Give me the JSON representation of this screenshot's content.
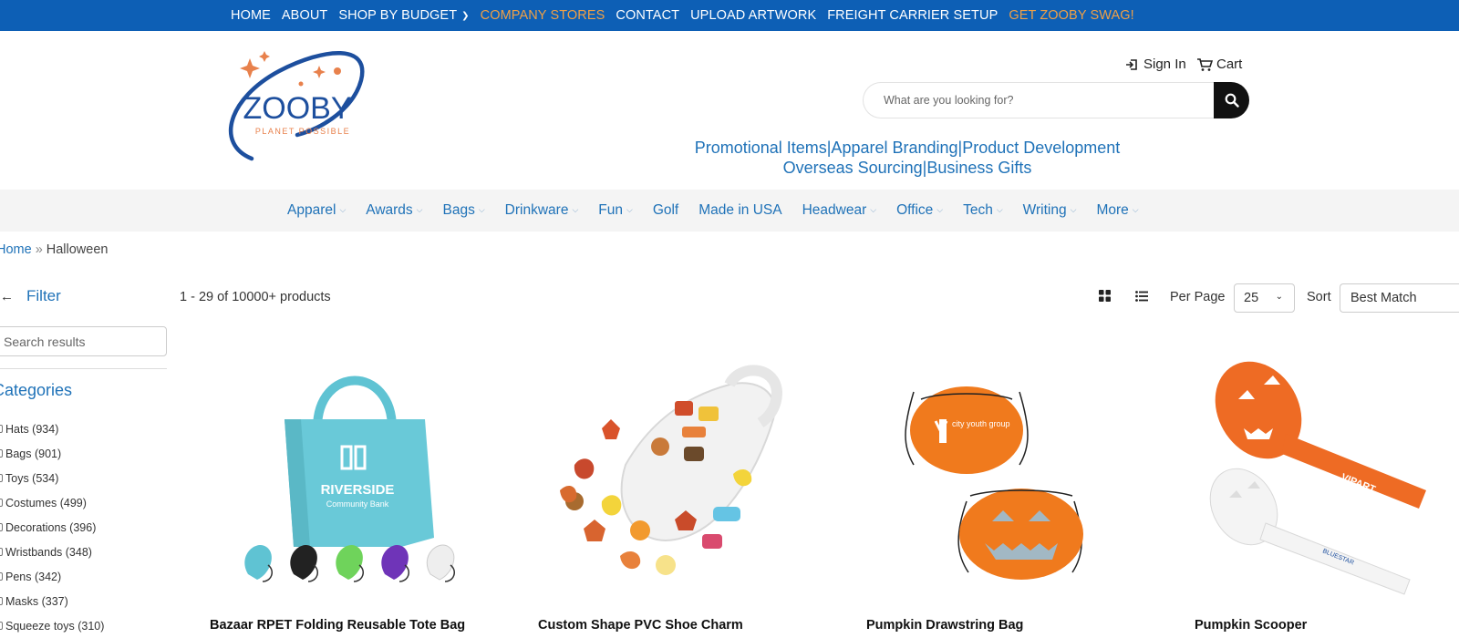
{
  "topnav": {
    "items": [
      {
        "label": "HOME",
        "highlight": false,
        "dropdown": false
      },
      {
        "label": "ABOUT",
        "highlight": false,
        "dropdown": false
      },
      {
        "label": "SHOP BY BUDGET",
        "highlight": false,
        "dropdown": true
      },
      {
        "label": "COMPANY STORES",
        "highlight": true,
        "dropdown": false
      },
      {
        "label": "CONTACT",
        "highlight": false,
        "dropdown": false
      },
      {
        "label": "UPLOAD ARTWORK",
        "highlight": false,
        "dropdown": false
      },
      {
        "label": "FREIGHT CARRIER SETUP",
        "highlight": false,
        "dropdown": false
      },
      {
        "label": "GET ZOOBY SWAG!",
        "highlight": true,
        "dropdown": false
      }
    ]
  },
  "logo": {
    "brand": "ZOOBY",
    "tagline": "PLANET POSSIBLE"
  },
  "header": {
    "sign_in": "Sign In",
    "cart": "Cart",
    "search_placeholder": "What are you looking for?",
    "tagline_line1": "Promotional Items|Apparel Branding|Product Development",
    "tagline_line2": "Overseas Sourcing|Business Gifts"
  },
  "catnav": {
    "items": [
      {
        "label": "Apparel",
        "dropdown": true
      },
      {
        "label": "Awards",
        "dropdown": true
      },
      {
        "label": "Bags",
        "dropdown": true
      },
      {
        "label": "Drinkware",
        "dropdown": true
      },
      {
        "label": "Fun",
        "dropdown": true
      },
      {
        "label": "Golf",
        "dropdown": false
      },
      {
        "label": "Made in USA",
        "dropdown": false
      },
      {
        "label": "Headwear",
        "dropdown": true
      },
      {
        "label": "Office",
        "dropdown": true
      },
      {
        "label": "Tech",
        "dropdown": true
      },
      {
        "label": "Writing",
        "dropdown": true
      },
      {
        "label": "More",
        "dropdown": true
      }
    ]
  },
  "breadcrumb": {
    "home": "Home",
    "separator": "»",
    "current": "Halloween"
  },
  "sidebar": {
    "filter_label": "Filter",
    "search_placeholder": "Search results",
    "categories_title": "Categories",
    "categories": [
      "Hats (934)",
      "Bags (901)",
      "Toys (534)",
      "Costumes (499)",
      "Decorations (396)",
      "Wristbands (348)",
      "Pens (342)",
      "Masks (337)",
      "Squeeze toys (310)"
    ]
  },
  "results": {
    "count_text": "1 - 29 of 10000+ products",
    "per_page_label": "Per Page",
    "per_page_value": "25",
    "sort_label": "Sort",
    "sort_value": "Best Match"
  },
  "products": [
    {
      "name": "Bazaar RPET Folding Reusable Tote Bag",
      "print": "RIVERSIDE",
      "print_sub": "Community Bank"
    },
    {
      "name": "Custom Shape PVC Shoe Charm"
    },
    {
      "name": "Pumpkin Drawstring Bag",
      "print": "city youth group"
    },
    {
      "name": "Pumpkin Scooper",
      "print": "VIPART",
      "print2": "BLUESTAR"
    }
  ],
  "colors": {
    "topbar_bg": "#0d5fb5",
    "accent_orange": "#f0a046",
    "link_blue": "#1f72b8",
    "catnav_bg": "#f4f4f4"
  }
}
